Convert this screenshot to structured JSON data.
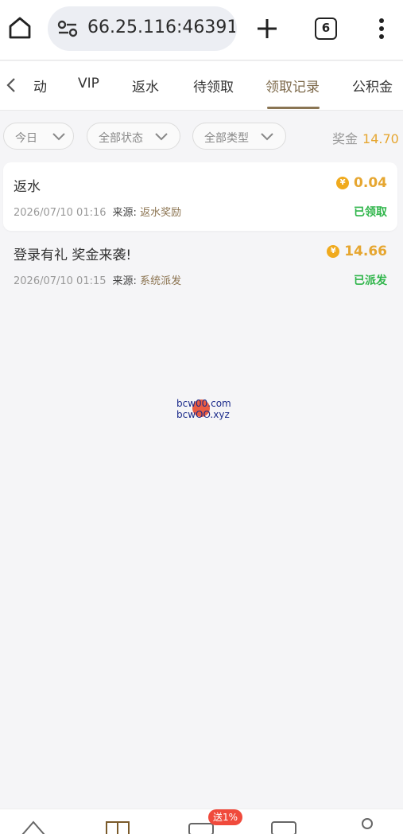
{
  "browser": {
    "url": "66.25.116:46391",
    "tab_count": "6"
  },
  "tabs": [
    {
      "label": "动",
      "active": false
    },
    {
      "label": "VIP",
      "active": false
    },
    {
      "label": "返水",
      "active": false
    },
    {
      "label": "待领取",
      "active": false
    },
    {
      "label": "领取记录",
      "active": true
    },
    {
      "label": "公积金",
      "active": false
    }
  ],
  "filters": {
    "date": "今日",
    "status": "全部状态",
    "type": "全部类型"
  },
  "bonus": {
    "label": "奖金",
    "value": "14.70"
  },
  "records": [
    {
      "title": "返水",
      "amount": "0.04",
      "datetime": "2026/07/10 01:16",
      "source_label": "来源:",
      "source": "返水奖励",
      "status": "已领取"
    },
    {
      "title": "登录有礼 奖金来袭!",
      "amount": "14.66",
      "datetime": "2026/07/10 01:15",
      "source_label": "来源:",
      "source": "系统派发",
      "status": "已派发"
    }
  ],
  "watermark": {
    "line1": "bcw00.com",
    "line2": "bcwOO.xyz"
  },
  "bottom_nav": {
    "promo_badge": "送1%"
  },
  "colors": {
    "accent": "#8a7553",
    "gold": "#e6a630",
    "success": "#2fb54a",
    "badge": "#f04a3c"
  }
}
